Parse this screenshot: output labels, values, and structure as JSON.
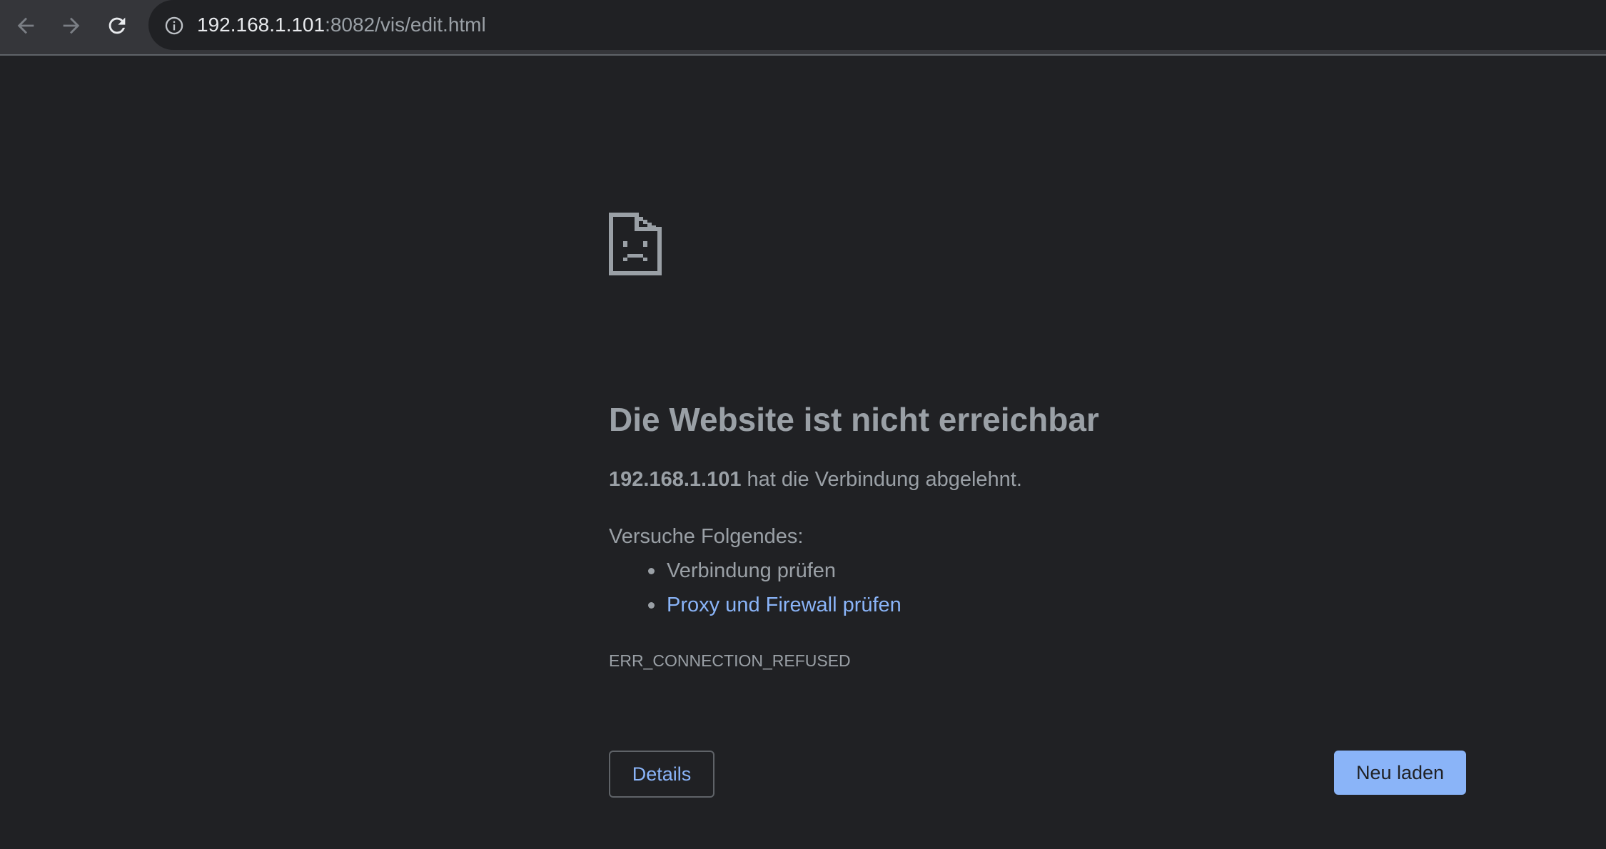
{
  "browser": {
    "url_host": "192.168.1.101",
    "url_path": ":8082/vis/edit.html",
    "icons": {
      "back": "arrow-left-icon",
      "forward": "arrow-right-icon",
      "reload": "reload-icon",
      "site_info": "info-icon"
    }
  },
  "error_page": {
    "icon": "sad-document-icon",
    "title": "Die Website ist nicht erreichbar",
    "summary_host": "192.168.1.101",
    "summary_text": " hat die Verbindung abgelehnt.",
    "suggestions_heading": "Versuche Folgendes:",
    "suggestions": [
      {
        "label": "Verbindung prüfen",
        "is_link": false
      },
      {
        "label": "Proxy und Firewall prüfen",
        "is_link": true
      }
    ],
    "error_code": "ERR_CONNECTION_REFUSED",
    "details_button": "Details",
    "reload_button": "Neu laden"
  },
  "colors": {
    "background": "#202124",
    "toolbar": "#35363a",
    "text_muted": "#9aa0a6",
    "link": "#8ab4f8",
    "primary_button": "#8ab4f8"
  }
}
